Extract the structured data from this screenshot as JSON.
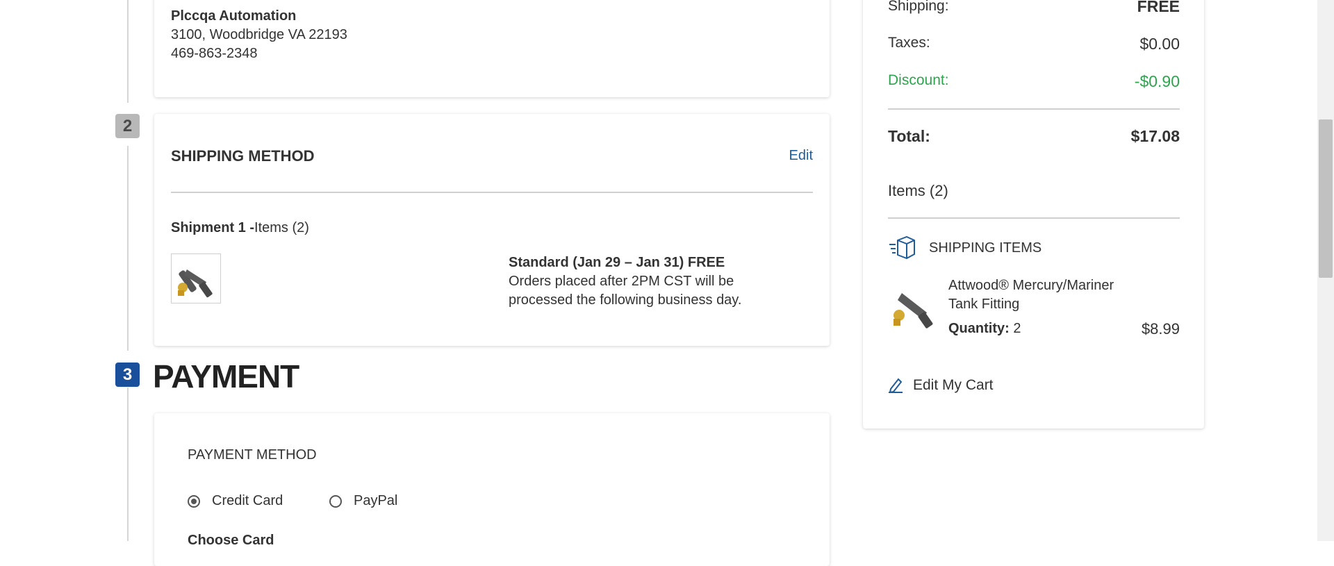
{
  "address": {
    "name": "Plccqa Automation",
    "line1": "3100, Woodbridge VA 22193",
    "phone": "469-863-2348"
  },
  "shipping_method": {
    "step": "2",
    "title": "SHIPPING METHOD",
    "edit_label": "Edit",
    "shipment_label": "Shipment 1 -",
    "shipment_items": "Items (2)",
    "option_title": "Standard (Jan 29 – Jan 31) FREE",
    "option_note_1": "Orders placed after 2PM CST will be",
    "option_note_2": "processed the following business day."
  },
  "payment": {
    "step": "3",
    "title": "PAYMENT",
    "method_label": "PAYMENT METHOD",
    "options": [
      "Credit Card",
      "PayPal"
    ],
    "selected": "Credit Card",
    "next_heading_partial": "Choose Card"
  },
  "summary": {
    "shipping_label": "Shipping:",
    "shipping_value": "FREE",
    "taxes_label": "Taxes:",
    "taxes_value": "$0.00",
    "discount_label": "Discount:",
    "discount_value": "-$0.90",
    "total_label": "Total:",
    "total_value": "$17.08",
    "items_label": "Items (2)",
    "shipping_items_label": "SHIPPING ITEMS",
    "product_name_1": "Attwood® Mercury/Mariner",
    "product_name_2": "Tank Fitting",
    "quantity_label": "Quantity:",
    "quantity_value": "2",
    "product_price": "$8.99",
    "edit_cart_label": "Edit My Cart"
  },
  "colors": {
    "link": "#1f5c99",
    "discount_green": "#2ea44f",
    "step_active": "#1a4f9c",
    "step_inactive": "#b8b8b8"
  }
}
